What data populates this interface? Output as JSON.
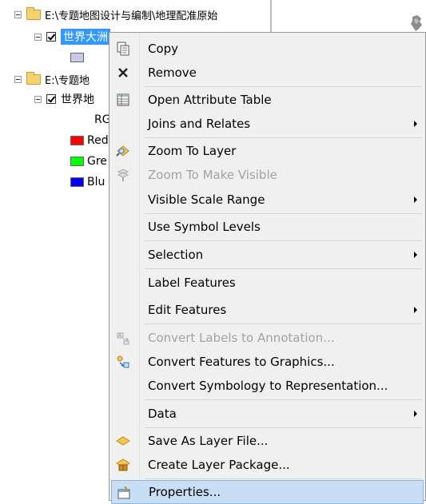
{
  "toc": {
    "group1_path": "E:\\专题地图设计与编制\\地理配准原始",
    "layer1_name": "世界大洲",
    "group2_path": "E:\\专题地",
    "layer2_name": "世界地",
    "raster_band_label": "RG",
    "bands": [
      {
        "label": "Red",
        "color": "#ff0000"
      },
      {
        "label": "Gre",
        "color": "#00ff00"
      },
      {
        "label": "Blu",
        "color": "#0000ff"
      }
    ],
    "layer1_symbol_color": "#c9c9ee"
  },
  "menu": {
    "items": [
      {
        "label": "Copy",
        "icon": "copy-icon"
      },
      {
        "label": "Remove",
        "icon": "remove-icon"
      },
      {
        "label": "Open Attribute Table",
        "icon": "table-icon"
      },
      {
        "label": "Joins and Relates",
        "submenu": true
      },
      {
        "label": "Zoom To Layer",
        "icon": "zoom-layer-icon"
      },
      {
        "label": "Zoom To Make Visible",
        "icon": "zoom-visible-icon",
        "disabled": true
      },
      {
        "label": "Visible Scale Range",
        "submenu": true
      },
      {
        "label": "Use Symbol Levels"
      },
      {
        "label": "Selection",
        "submenu": true
      },
      {
        "label": "Label Features"
      },
      {
        "label": "Edit Features",
        "submenu": true
      },
      {
        "label": "Convert Labels to Annotation...",
        "icon": "convert-labels-icon",
        "disabled": true
      },
      {
        "label": "Convert Features to Graphics...",
        "icon": "convert-graphics-icon"
      },
      {
        "label": "Convert Symbology to Representation..."
      },
      {
        "label": "Data",
        "submenu": true
      },
      {
        "label": "Save As Layer File...",
        "icon": "layer-file-icon"
      },
      {
        "label": "Create Layer Package...",
        "icon": "layer-package-icon"
      },
      {
        "label": "Properties...",
        "icon": "properties-icon",
        "hover": true
      }
    ]
  }
}
